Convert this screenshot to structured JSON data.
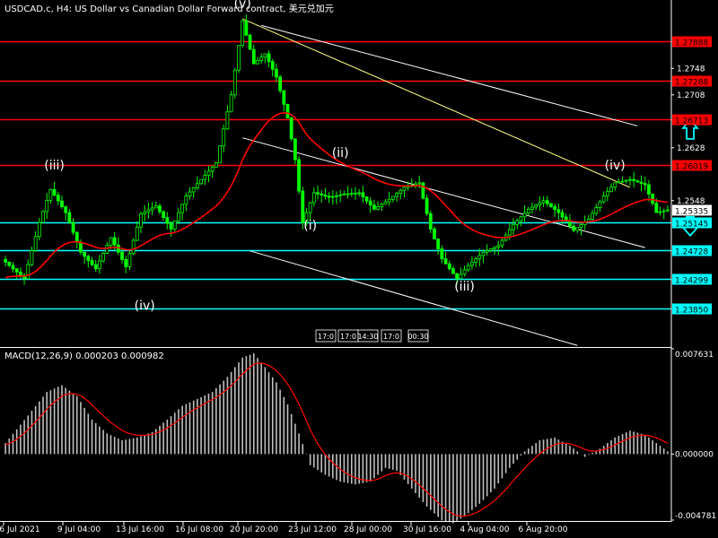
{
  "header": {
    "symbol_line": "USDCAD.c, H4:  US Dollar vs Canadian Dollar Forward contract, 美元兑加元",
    "macd_line": "MACD(12,26,9) 0.000203 0.000982"
  },
  "colors": {
    "background": "#000000",
    "candle": "#00ff00",
    "ma": "#ff0000",
    "resistance": "#ff0000",
    "support": "#00ffff",
    "trend_yellow": "#ffff80",
    "trend_white": "#ffffff",
    "arrow": "#00ffff",
    "macd_hist": "#c0c0c0",
    "macd_signal": "#ff0000"
  },
  "chart_data": [
    {
      "type": "candlestick",
      "title": "USDCAD.c, H4",
      "ylim": [
        1.2328,
        1.2846
      ],
      "price_axis_ticks": [
        1.2548,
        1.2628,
        1.2708,
        1.2748
      ],
      "x_tick_labels": [
        "6 Jul 2021",
        "9 Jul 04:00",
        "13 Jul 16:00",
        "16 Jul 08:00",
        "20 Jul 20:00",
        "23 Jul 12:00",
        "28 Jul 00:00",
        "30 Jul 16:00",
        "4 Aug 04:00",
        "6 Aug 20:00"
      ],
      "session_labels": [
        "17:0",
        "17:0",
        "14:30",
        "17:0",
        "00:30"
      ],
      "current_price": 1.25335,
      "horizontal_levels": [
        {
          "price": 1.27888,
          "label": "1.27888",
          "kind": "resistance"
        },
        {
          "price": 1.27288,
          "label": "1.27288",
          "kind": "resistance"
        },
        {
          "price": 1.26713,
          "label": "1.26713",
          "kind": "resistance"
        },
        {
          "price": 1.26019,
          "label": "1.26019",
          "kind": "resistance"
        },
        {
          "price": 1.25145,
          "label": "1.25145",
          "kind": "support"
        },
        {
          "price": 1.24728,
          "label": "1.24728",
          "kind": "support"
        },
        {
          "price": 1.24299,
          "label": "1.24299",
          "kind": "support"
        },
        {
          "price": 1.2385,
          "label": "1.23850",
          "kind": "support"
        }
      ],
      "wave_labels": [
        {
          "text": "(iii)",
          "bar": 13,
          "price": 1.2595
        },
        {
          "text": "(iv)",
          "bar": 37,
          "price": 1.2383
        },
        {
          "text": "(v)",
          "bar": 63,
          "price": 1.284
        },
        {
          "text": "(ii)",
          "bar": 89,
          "price": 1.2614
        },
        {
          "text": "(i)",
          "bar": 81,
          "price": 1.2504
        },
        {
          "text": "(iii)",
          "bar": 122,
          "price": 1.2412
        },
        {
          "text": "(iv)",
          "bar": 162,
          "price": 1.2595
        }
      ],
      "trend_lines": [
        {
          "from": [
            63,
            1.2823
          ],
          "to": [
            166,
            1.2568
          ],
          "style": "yellow"
        },
        {
          "from": [
            68,
            1.2813
          ],
          "to": [
            168,
            1.2661
          ],
          "style": "white"
        },
        {
          "from": [
            63,
            1.2643
          ],
          "to": [
            170,
            1.2477
          ],
          "style": "white"
        },
        {
          "from": [
            65,
            1.2472
          ],
          "to": [
            152,
            1.2329
          ],
          "style": "white"
        }
      ],
      "arrows": [
        {
          "direction": "up",
          "bar": 182,
          "price": 1.2655
        },
        {
          "direction": "down",
          "bar": 182,
          "price": 1.251
        }
      ],
      "anchors": [
        [
          0,
          1.2455
        ],
        [
          5,
          1.243
        ],
        [
          9,
          1.2515
        ],
        [
          12,
          1.2565
        ],
        [
          16,
          1.253
        ],
        [
          20,
          1.247
        ],
        [
          24,
          1.2445
        ],
        [
          28,
          1.2492
        ],
        [
          32,
          1.2448
        ],
        [
          36,
          1.2528
        ],
        [
          40,
          1.254
        ],
        [
          44,
          1.2505
        ],
        [
          48,
          1.2555
        ],
        [
          52,
          1.258
        ],
        [
          56,
          1.2605
        ],
        [
          60,
          1.2708
        ],
        [
          63,
          1.282
        ],
        [
          66,
          1.2755
        ],
        [
          69,
          1.277
        ],
        [
          72,
          1.2735
        ],
        [
          75,
          1.2673
        ],
        [
          77,
          1.261
        ],
        [
          79,
          1.2515
        ],
        [
          82,
          1.256
        ],
        [
          86,
          1.2553
        ],
        [
          90,
          1.2558
        ],
        [
          94,
          1.256
        ],
        [
          98,
          1.2535
        ],
        [
          102,
          1.255
        ],
        [
          106,
          1.2568
        ],
        [
          110,
          1.2575
        ],
        [
          113,
          1.2505
        ],
        [
          116,
          1.246
        ],
        [
          120,
          1.243
        ],
        [
          123,
          1.245
        ],
        [
          127,
          1.247
        ],
        [
          131,
          1.248
        ],
        [
          135,
          1.2512
        ],
        [
          139,
          1.2535
        ],
        [
          143,
          1.2548
        ],
        [
          147,
          1.253
        ],
        [
          151,
          1.2503
        ],
        [
          155,
          1.252
        ],
        [
          159,
          1.2555
        ],
        [
          162,
          1.2575
        ],
        [
          166,
          1.258
        ],
        [
          170,
          1.2572
        ],
        [
          173,
          1.253
        ],
        [
          176,
          1.2534
        ]
      ]
    },
    {
      "type": "macd_histogram",
      "title": "MACD(12,26,9)",
      "macd": 0.000203,
      "signal": 0.000982,
      "ylim": [
        -0.004781,
        0.007631
      ],
      "axis_ticks": [
        {
          "value": 0.007631,
          "label": "0.007631"
        },
        {
          "value": 0.0,
          "label": "0.000000"
        },
        {
          "value": -0.004781,
          "label": "-0.004781"
        }
      ],
      "anchors": [
        [
          0,
          0.0008
        ],
        [
          6,
          0.0028
        ],
        [
          11,
          0.0045
        ],
        [
          15,
          0.005
        ],
        [
          19,
          0.0042
        ],
        [
          23,
          0.0025
        ],
        [
          27,
          0.0015
        ],
        [
          31,
          0.001
        ],
        [
          35,
          0.0012
        ],
        [
          39,
          0.0016
        ],
        [
          43,
          0.0025
        ],
        [
          47,
          0.0035
        ],
        [
          51,
          0.004
        ],
        [
          55,
          0.0045
        ],
        [
          59,
          0.0056
        ],
        [
          63,
          0.007
        ],
        [
          66,
          0.0073
        ],
        [
          69,
          0.0063
        ],
        [
          72,
          0.0052
        ],
        [
          75,
          0.0036
        ],
        [
          78,
          0.0015
        ],
        [
          81,
          -0.0008
        ],
        [
          85,
          -0.0015
        ],
        [
          89,
          -0.002
        ],
        [
          93,
          -0.0022
        ],
        [
          97,
          -0.002
        ],
        [
          101,
          -0.001
        ],
        [
          104,
          -0.0012
        ],
        [
          108,
          -0.0025
        ],
        [
          112,
          -0.0038
        ],
        [
          116,
          -0.0048
        ],
        [
          119,
          -0.005
        ],
        [
          122,
          -0.0045
        ],
        [
          126,
          -0.0036
        ],
        [
          130,
          -0.0025
        ],
        [
          134,
          -0.001
        ],
        [
          138,
          0.0002
        ],
        [
          142,
          0.001
        ],
        [
          146,
          0.0012
        ],
        [
          150,
          0.0006
        ],
        [
          154,
          -0.0002
        ],
        [
          158,
          0.0004
        ],
        [
          162,
          0.0012
        ],
        [
          166,
          0.0017
        ],
        [
          170,
          0.0014
        ],
        [
          173,
          0.0008
        ],
        [
          176,
          0.0002
        ]
      ]
    }
  ]
}
